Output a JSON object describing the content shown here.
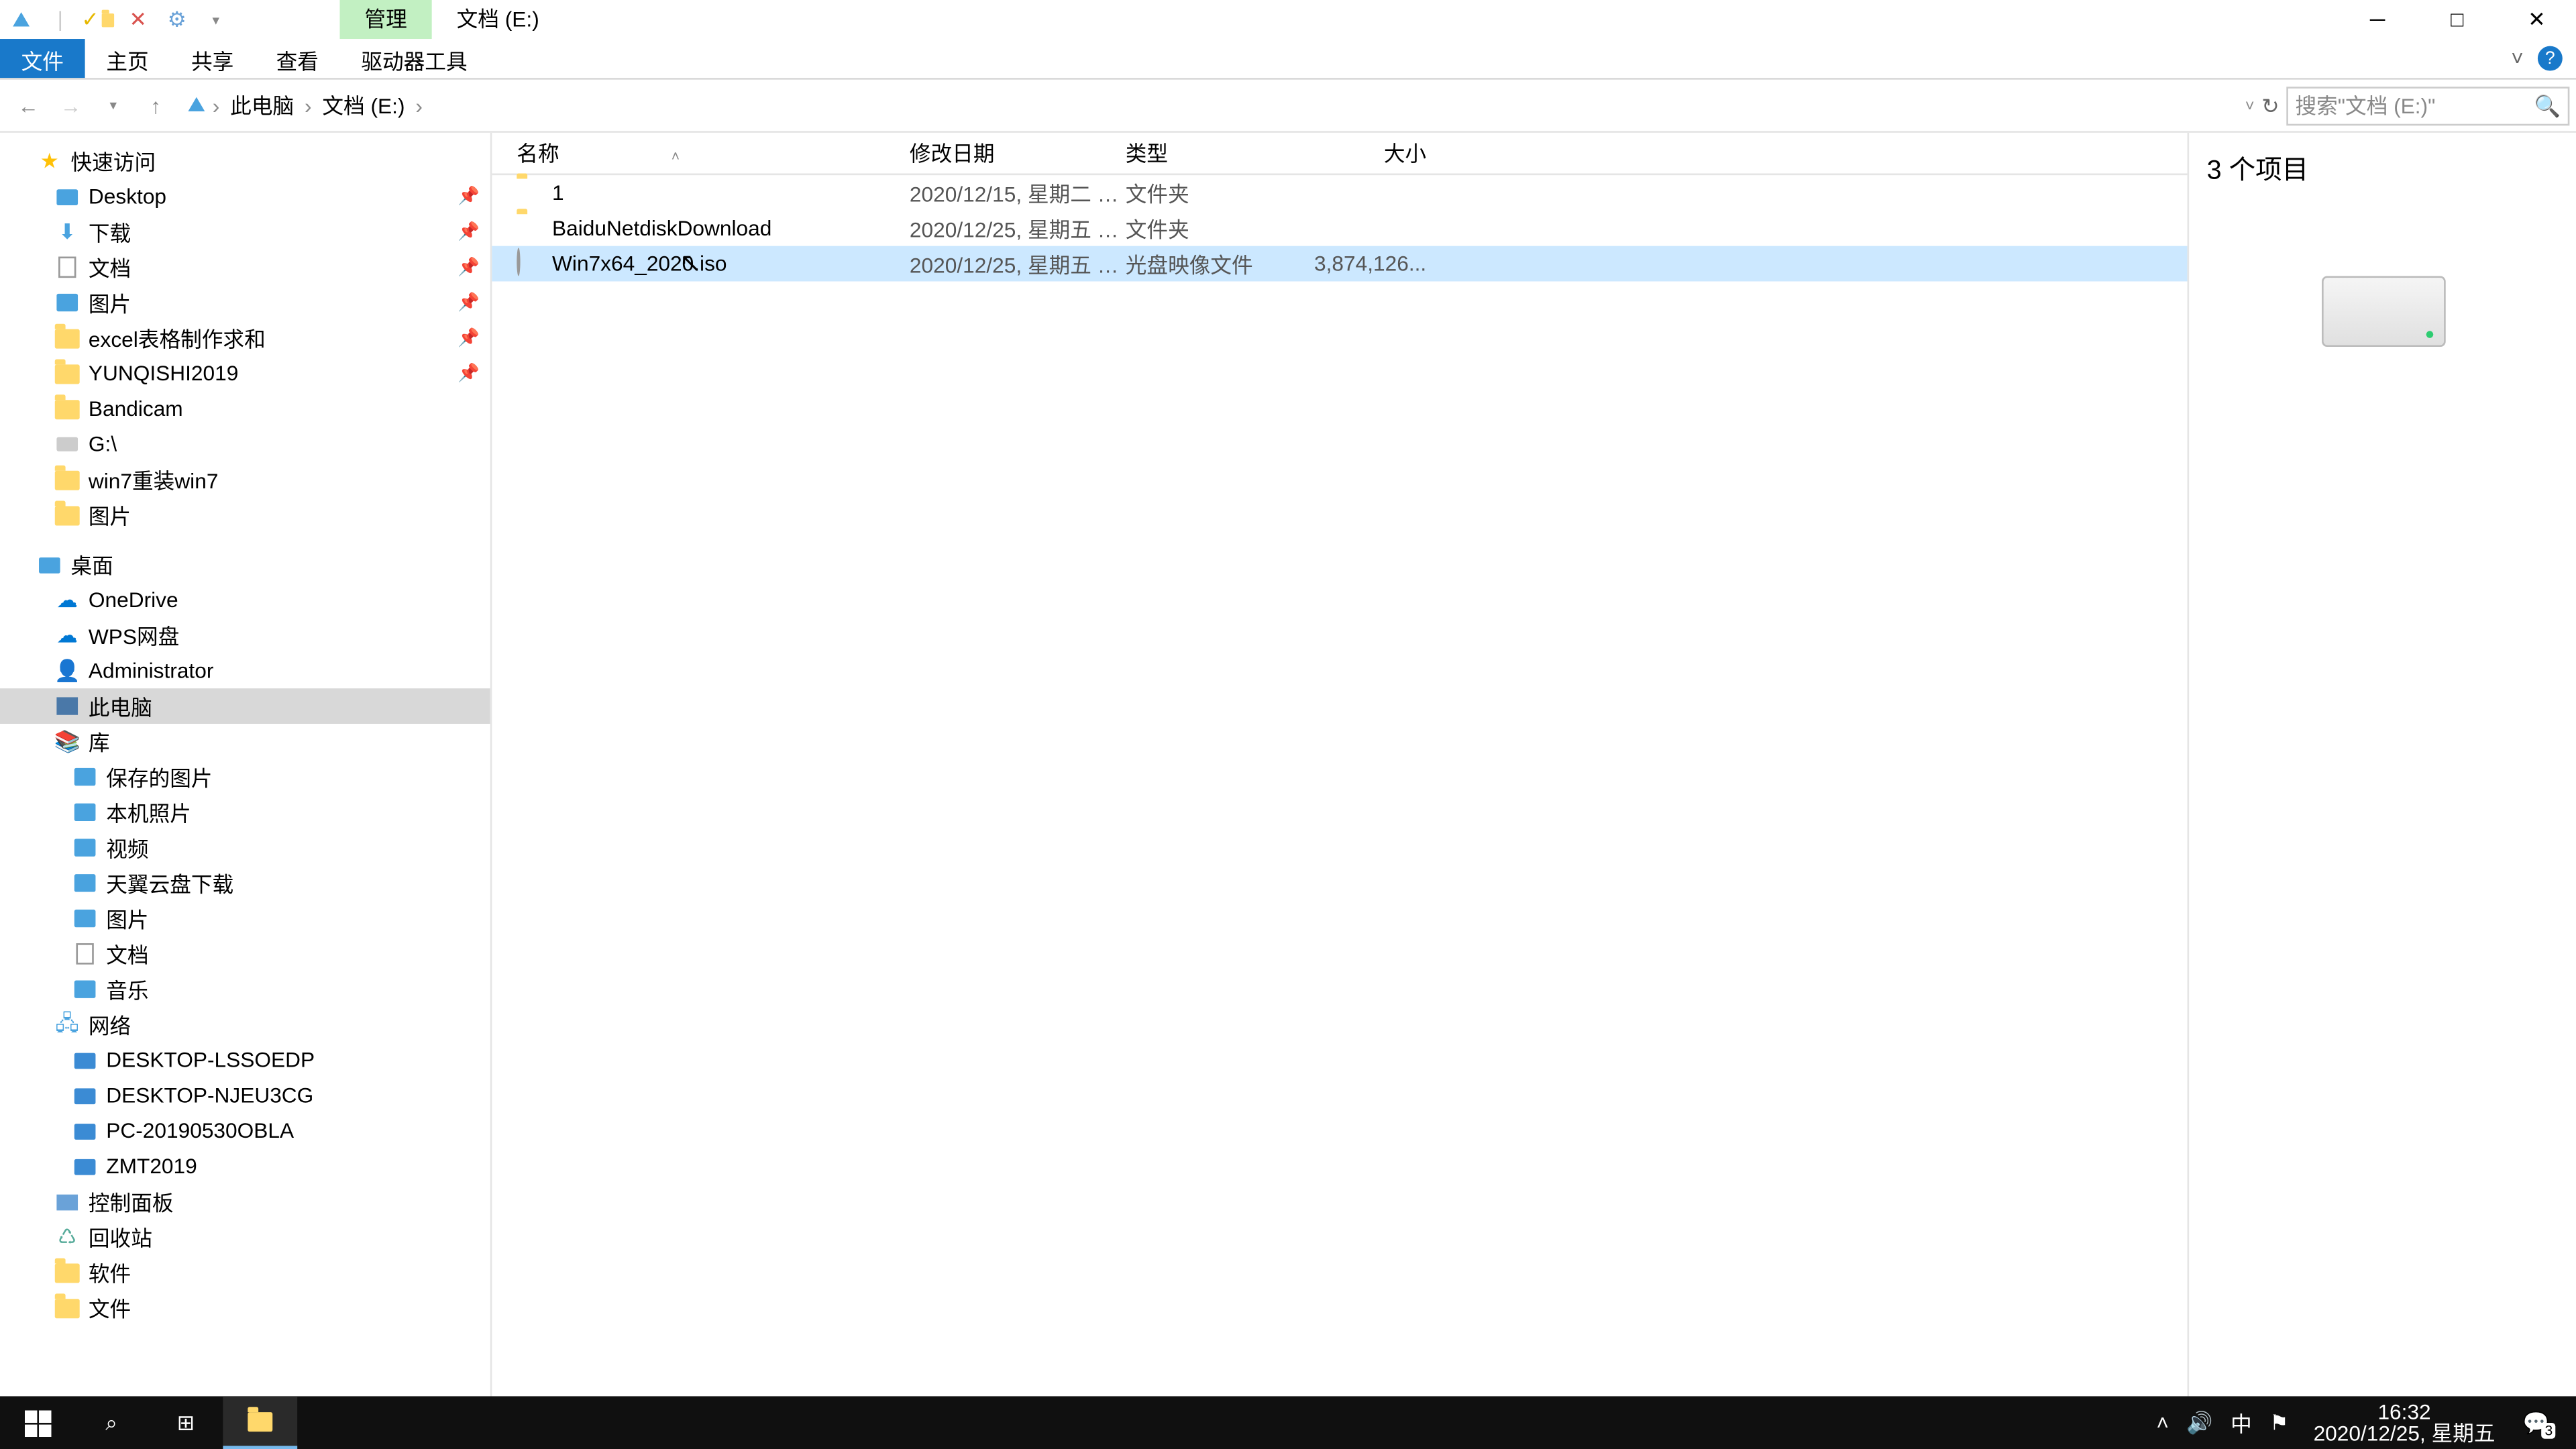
{
  "title": {
    "context_tab": "管理",
    "location_tab": "文档 (E:)"
  },
  "ribbon": {
    "file": "文件",
    "tabs": [
      "主页",
      "共享",
      "查看",
      "驱动器工具"
    ]
  },
  "breadcrumb": {
    "segments": [
      "此电脑",
      "文档 (E:)"
    ]
  },
  "search": {
    "placeholder": "搜索\"文档 (E:)\""
  },
  "nav": {
    "quick_access": "快速访问",
    "quick_items": [
      {
        "label": "Desktop",
        "icon": "desktop",
        "pinned": true
      },
      {
        "label": "下载",
        "icon": "download",
        "pinned": true
      },
      {
        "label": "文档",
        "icon": "doc",
        "pinned": true
      },
      {
        "label": "图片",
        "icon": "pic",
        "pinned": true
      },
      {
        "label": "excel表格制作求和",
        "icon": "folder",
        "pinned": true
      },
      {
        "label": "YUNQISHI2019",
        "icon": "folder",
        "pinned": true
      },
      {
        "label": "Bandicam",
        "icon": "folder",
        "pinned": false
      },
      {
        "label": "G:\\",
        "icon": "drive",
        "pinned": false
      },
      {
        "label": "win7重装win7",
        "icon": "folder",
        "pinned": false
      },
      {
        "label": "图片",
        "icon": "folder",
        "pinned": false
      }
    ],
    "desktop": "桌面",
    "desktop_items": [
      {
        "label": "OneDrive",
        "icon": "cloud"
      },
      {
        "label": "WPS网盘",
        "icon": "cloud"
      },
      {
        "label": "Administrator",
        "icon": "user"
      },
      {
        "label": "此电脑",
        "icon": "pc",
        "selected": true
      },
      {
        "label": "库",
        "icon": "lib"
      }
    ],
    "lib_items": [
      {
        "label": "保存的图片",
        "icon": "pic"
      },
      {
        "label": "本机照片",
        "icon": "pic"
      },
      {
        "label": "视频",
        "icon": "pic"
      },
      {
        "label": "天翼云盘下载",
        "icon": "pic"
      },
      {
        "label": "图片",
        "icon": "pic"
      },
      {
        "label": "文档",
        "icon": "doc"
      },
      {
        "label": "音乐",
        "icon": "pic"
      }
    ],
    "network": "网络",
    "network_items": [
      {
        "label": "DESKTOP-LSSOEDP",
        "icon": "monitor"
      },
      {
        "label": "DESKTOP-NJEU3CG",
        "icon": "monitor"
      },
      {
        "label": "PC-20190530OBLA",
        "icon": "monitor"
      },
      {
        "label": "ZMT2019",
        "icon": "monitor"
      }
    ],
    "extras": [
      {
        "label": "控制面板",
        "icon": "panel"
      },
      {
        "label": "回收站",
        "icon": "recycle"
      },
      {
        "label": "软件",
        "icon": "folder"
      },
      {
        "label": "文件",
        "icon": "folder"
      }
    ]
  },
  "columns": {
    "name": "名称",
    "date": "修改日期",
    "type": "类型",
    "size": "大小"
  },
  "files": [
    {
      "name": "1",
      "date": "2020/12/15, 星期二 1...",
      "type": "文件夹",
      "size": "",
      "icon": "folder",
      "selected": false
    },
    {
      "name": "BaiduNetdiskDownload",
      "date": "2020/12/25, 星期五 1...",
      "type": "文件夹",
      "size": "",
      "icon": "folder",
      "selected": false
    },
    {
      "name": "Win7x64_2020.iso",
      "date": "2020/12/25, 星期五 1...",
      "type": "光盘映像文件",
      "size": "3,874,126...",
      "icon": "iso",
      "selected": true
    }
  ],
  "preview": {
    "count": "3 个项目"
  },
  "status": {
    "text": "3 个项目"
  },
  "taskbar": {
    "time": "16:32",
    "date": "2020/12/25, 星期五",
    "ime": "中",
    "notify_count": "3"
  }
}
